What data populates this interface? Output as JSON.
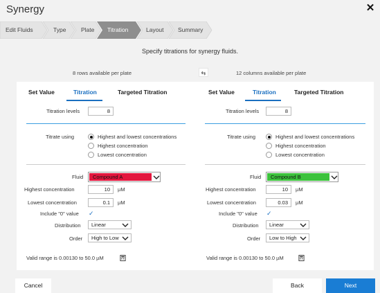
{
  "window": {
    "title": "Synergy",
    "close_glyph": "✕"
  },
  "steps": [
    {
      "label": "Edit Fluids"
    },
    {
      "label": "Type"
    },
    {
      "label": "Plate"
    },
    {
      "label": "Titration",
      "active": true
    },
    {
      "label": "Layout"
    },
    {
      "label": "Summary"
    }
  ],
  "subtitle": "Specify titrations for synergy fluids.",
  "swap_icon": "swap-rows-columns-icon",
  "panels": {
    "left": {
      "availability": "8 rows available per plate",
      "tabs": [
        "Set Value",
        "Titration",
        "Targeted Titration"
      ],
      "active_tab": "Titration",
      "titration_levels_label": "Titration levels",
      "titration_levels": "8",
      "titrate_label": "Titrate using",
      "titrate_options": [
        "Highest and lowest concentrations",
        "Highest concentration",
        "Lowest concentration"
      ],
      "titrate_selected": 0,
      "fluid_label": "Fluid",
      "fluid_name": "Compound A",
      "fluid_color": "#e3173e",
      "highest_label": "Highest concentration",
      "highest_value": "10",
      "lowest_label": "Lowest concentration",
      "lowest_value": "0.1",
      "unit": "µM",
      "include_zero_label": "Include \"0\" value",
      "include_zero_checked": true,
      "distribution_label": "Distribution",
      "distribution_value": "Linear",
      "order_label": "Order",
      "order_value": "High to Low",
      "valid_range": "Valid range is 0.00130 to 50.0 µM"
    },
    "right": {
      "availability": "12 columns available per plate",
      "tabs": [
        "Set Value",
        "Titration",
        "Targeted Titration"
      ],
      "active_tab": "Titration",
      "titration_levels_label": "Titration levels",
      "titration_levels": "8",
      "titrate_label": "Titrate using",
      "titrate_options": [
        "Highest and lowest concentrations",
        "Highest concentration",
        "Lowest concentration"
      ],
      "titrate_selected": 0,
      "fluid_label": "Fluid",
      "fluid_name": "Compound B",
      "fluid_color": "#3cc23c",
      "highest_label": "Highest concentration",
      "highest_value": "10",
      "lowest_label": "Lowest concentration",
      "lowest_value": "0.03",
      "unit": "µM",
      "include_zero_label": "Include \"0\" value",
      "include_zero_checked": true,
      "distribution_label": "Distribution",
      "distribution_value": "Linear",
      "order_label": "Order",
      "order_value": "Low to High",
      "valid_range": "Valid range is 0.00130 to 50.0 µM"
    }
  },
  "footer": {
    "cancel": "Cancel",
    "back": "Back",
    "next": "Next"
  },
  "colors": {
    "accent": "#1a7dd4",
    "active_step": "#8e8e8e"
  }
}
